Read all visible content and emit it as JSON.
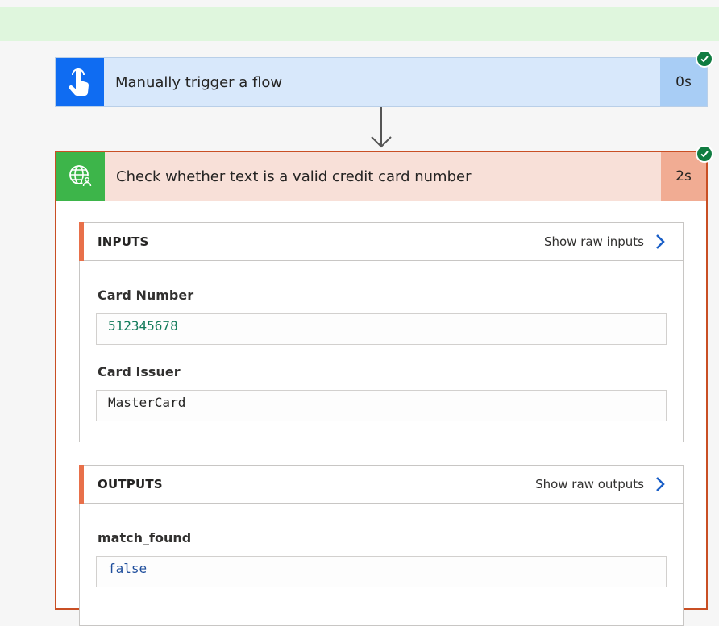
{
  "trigger": {
    "title": "Manually trigger a flow",
    "duration": "0s",
    "icon": "touch-hand-icon",
    "status": "success"
  },
  "action": {
    "title": "Check whether text is a valid credit card number",
    "duration": "2s",
    "icon": "globe-person-icon",
    "status": "success",
    "inputs": {
      "title": "INPUTS",
      "raw_link": "Show raw inputs",
      "fields": [
        {
          "label": "Card Number",
          "value": "512345678"
        },
        {
          "label": "Card Issuer",
          "value": "MasterCard"
        }
      ]
    },
    "outputs": {
      "title": "OUTPUTS",
      "raw_link": "Show raw outputs",
      "fields": [
        {
          "label": "match_found",
          "value": "false"
        }
      ]
    }
  },
  "colors": {
    "trigger_blue": "#0f6cf2",
    "action_green": "#3db54a",
    "action_border": "#c94f24",
    "success_green": "#107c41",
    "link_blue": "#1a5fc7"
  }
}
